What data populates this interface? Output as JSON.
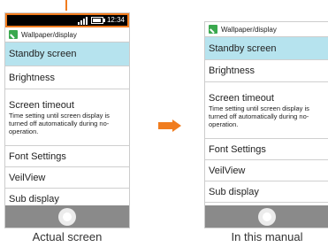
{
  "status": {
    "time": "12:34"
  },
  "app": {
    "title": "Wallpaper/display"
  },
  "menu": {
    "items": [
      {
        "label": "Standby screen"
      },
      {
        "label": "Brightness"
      },
      {
        "label": "Screen timeout",
        "subtitle": "Time setting until screen display is turned off automatically during no-operation."
      },
      {
        "label": "Font Settings"
      },
      {
        "label": "VeilView"
      },
      {
        "label": "Sub display"
      }
    ]
  },
  "captions": {
    "actual": "Actual screen",
    "manual": "In this manual"
  },
  "colors": {
    "accent": "#f07c1f",
    "highlight": "#b6e3ee",
    "navbar": "#8a8a8a",
    "app_icon": "#3aa84e"
  },
  "icons": {
    "app": "wallpaper-icon",
    "signal": "signal-strength-icon",
    "battery": "battery-icon",
    "home": "home-button-icon",
    "arrow": "arrow-right-icon"
  }
}
